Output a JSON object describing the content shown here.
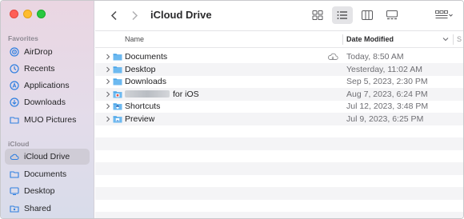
{
  "window": {
    "title": "iCloud Drive"
  },
  "sidebar": {
    "sections": [
      {
        "label": "Favorites"
      },
      {
        "label": "iCloud"
      }
    ],
    "favorites": [
      {
        "label": "AirDrop",
        "icon": "airdrop-icon"
      },
      {
        "label": "Recents",
        "icon": "clock-icon"
      },
      {
        "label": "Applications",
        "icon": "applications-icon"
      },
      {
        "label": "Downloads",
        "icon": "download-icon"
      },
      {
        "label": "MUO Pictures",
        "icon": "folder-icon"
      }
    ],
    "icloud": [
      {
        "label": "iCloud Drive",
        "icon": "cloud-icon",
        "active": true
      },
      {
        "label": "Documents",
        "icon": "document-icon"
      },
      {
        "label": "Desktop",
        "icon": "desktop-icon"
      },
      {
        "label": "Shared",
        "icon": "shared-folder-icon"
      }
    ]
  },
  "columns": {
    "name": "Name",
    "date_modified": "Date Modified",
    "more": "S"
  },
  "files": [
    {
      "name": "Documents",
      "date": "Today, 8:50 AM",
      "cloud": true,
      "icon": "folder-icon"
    },
    {
      "name": "Desktop",
      "date": "Yesterday, 11:02 AM",
      "icon": "folder-icon"
    },
    {
      "name": "Downloads",
      "date": "Sep 5, 2023, 2:30 PM",
      "icon": "folder-icon"
    },
    {
      "name": "for iOS",
      "date": "Aug 7, 2023, 6:24 PM",
      "icon": "app-folder-icon",
      "redacted": true
    },
    {
      "name": "Shortcuts",
      "date": "Jul 12, 2023, 3:48 PM",
      "icon": "shortcuts-folder-icon"
    },
    {
      "name": "Preview",
      "date": "Jul 9, 2023, 6:25 PM",
      "icon": "preview-folder-icon"
    }
  ],
  "colors": {
    "folder": "#4aa5e8",
    "accent": "#1c7ef0"
  }
}
